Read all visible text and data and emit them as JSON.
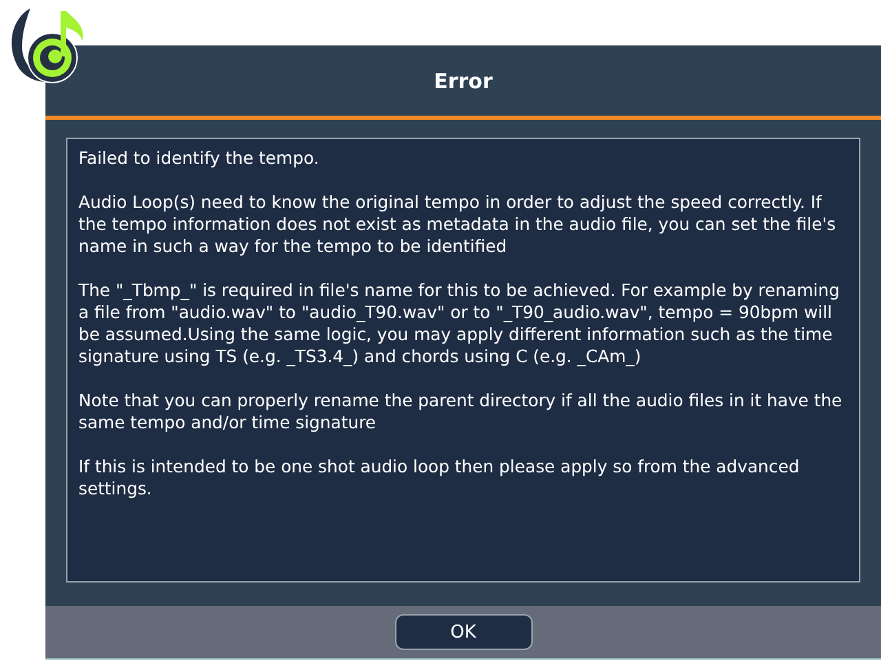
{
  "dialog": {
    "title": "Error",
    "paragraphs": [
      "Failed to identify the tempo.",
      "Audio Loop(s) need to know the original tempo in order to adjust the speed correctly. If the tempo information does not exist as metadata in the audio file, you can set the file's name in such a way for the tempo to be identified",
      "The \"_Tbmp_\" is required in file's name for this to be achieved. For example by renaming a file from \"audio.wav\" to \"audio_T90.wav\" or to \"_T90_audio.wav\", tempo = 90bpm will be assumed.Using the same logic, you may apply different information such as the time signature using TS (e.g. _TS3.4_) and chords using C (e.g. _CAm_)",
      "Note that you can properly rename the parent directory if all the audio files in it have the same tempo and/or time signature",
      "If this is intended to be one shot audio loop then please apply so from the advanced settings."
    ],
    "buttons": [
      "OK"
    ]
  }
}
